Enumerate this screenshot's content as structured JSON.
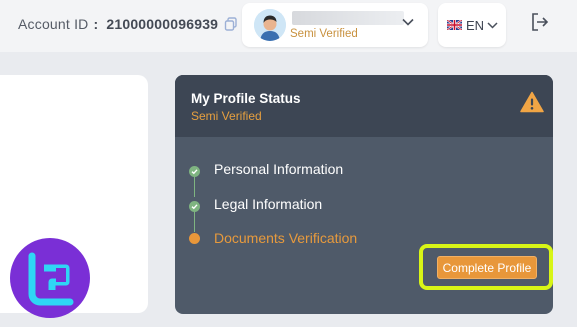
{
  "header": {
    "account_label": "Account ID",
    "account_separator": ":",
    "account_id": "21000000096939",
    "user_status": "Semi Verified",
    "language": "EN"
  },
  "profile_status": {
    "title": "My Profile Status",
    "subtitle": "Semi Verified",
    "steps": [
      {
        "label": "Personal Information",
        "state": "done"
      },
      {
        "label": "Legal Information",
        "state": "done"
      },
      {
        "label": "Documents Verification",
        "state": "pending"
      }
    ],
    "cta_label": "Complete Profile"
  },
  "colors": {
    "accent_orange": "#e8973a",
    "card_bg": "#4f5a69",
    "card_header_bg": "#3d4654",
    "done_green": "#7fb481",
    "highlight": "#d8f516",
    "brand_purple": "#7a2fd6"
  },
  "icons": {
    "copy": "copy-icon",
    "chevron": "chevron-down-icon",
    "flag": "uk-flag-icon",
    "logout": "logout-icon",
    "warning": "warning-icon",
    "brand": "brand-logo-icon"
  }
}
